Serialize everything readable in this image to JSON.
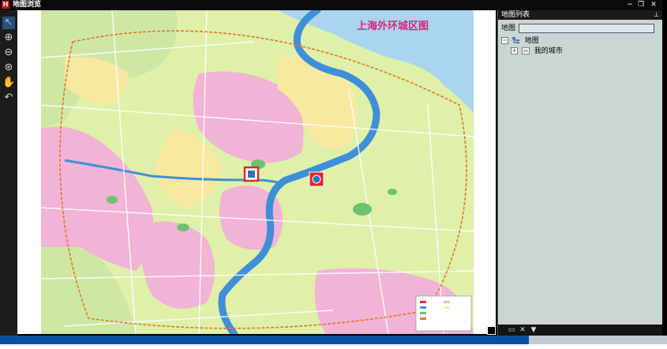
{
  "window": {
    "app_icon_letter": "H",
    "title": "地图浏览",
    "minimize": "−",
    "restore": "❐",
    "close": "✕"
  },
  "toolbar": {
    "tools": [
      {
        "name": "select-arrow-icon",
        "glyph": "↖"
      },
      {
        "name": "zoom-in-icon",
        "glyph": "⊕"
      },
      {
        "name": "zoom-out-icon",
        "glyph": "⊖"
      },
      {
        "name": "full-extent-icon",
        "glyph": "⊛"
      },
      {
        "name": "pan-hand-icon",
        "glyph": "✋"
      },
      {
        "name": "undo-back-icon",
        "glyph": "↶"
      }
    ]
  },
  "map": {
    "title": "上海外环城区图",
    "colors": {
      "water": "#a9d5ef",
      "river": "#3f8fd8",
      "district_pink": "#f1b3d6",
      "district_yellow": "#f7eaa0",
      "district_green": "#cfe7a5",
      "district_lime": "#dff0a9",
      "park": "#6cc36e",
      "marker_border": "#e0282a"
    }
  },
  "panel": {
    "title": "地图列表",
    "pin": "⊥",
    "filter_label": "地图",
    "filter_value": "",
    "tree": {
      "root_expander": "−",
      "root_label": "地图",
      "child_expander": "+",
      "child_label": "我的城市"
    },
    "footer_buttons": [
      {
        "name": "folder-icon",
        "glyph": "▭"
      },
      {
        "name": "delete-icon",
        "glyph": "✕"
      },
      {
        "name": "filter-icon",
        "glyph": "▼"
      }
    ]
  }
}
